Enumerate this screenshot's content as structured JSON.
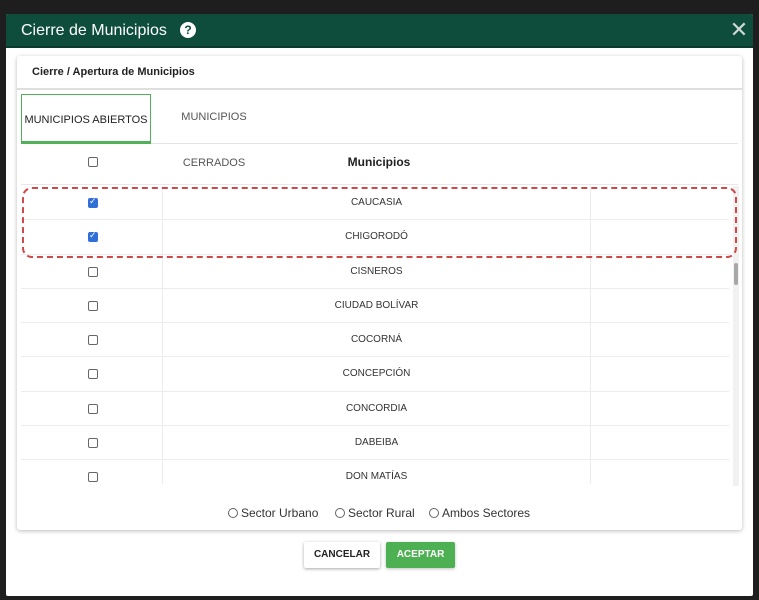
{
  "modal": {
    "title": "Cierre de Municipios",
    "help_icon_glyph": "?",
    "close_icon_glyph": "✕"
  },
  "card": {
    "title": "Cierre / Apertura de Municipios"
  },
  "tabs": [
    {
      "label": "MUNICIPIOS ABIERTOS",
      "active": true
    },
    {
      "label": "MUNICIPIOS CERRADOS",
      "active": false
    }
  ],
  "table": {
    "header": "Municipios",
    "rows": [
      {
        "name": "CAUCASIA",
        "checked": true
      },
      {
        "name": "CHIGORODÓ",
        "checked": true
      },
      {
        "name": "CISNEROS",
        "checked": false
      },
      {
        "name": "CIUDAD BOLÍVAR",
        "checked": false
      },
      {
        "name": "COCORNÁ",
        "checked": false
      },
      {
        "name": "CONCEPCIÓN",
        "checked": false
      },
      {
        "name": "CONCORDIA",
        "checked": false
      },
      {
        "name": "DABEIBA",
        "checked": false
      },
      {
        "name": "DON MATÍAS",
        "checked": false
      }
    ]
  },
  "sectors": [
    {
      "label": "Sector Urbano"
    },
    {
      "label": "Sector Rural"
    },
    {
      "label": "Ambos Sectores"
    }
  ],
  "buttons": {
    "cancel": "CANCELAR",
    "accept": "ACEPTAR"
  },
  "colors": {
    "header_bg": "#0e4d3c",
    "accent_green": "#4db053",
    "checkbox_blue": "#2f6fd6",
    "highlight_red": "#d04848"
  }
}
